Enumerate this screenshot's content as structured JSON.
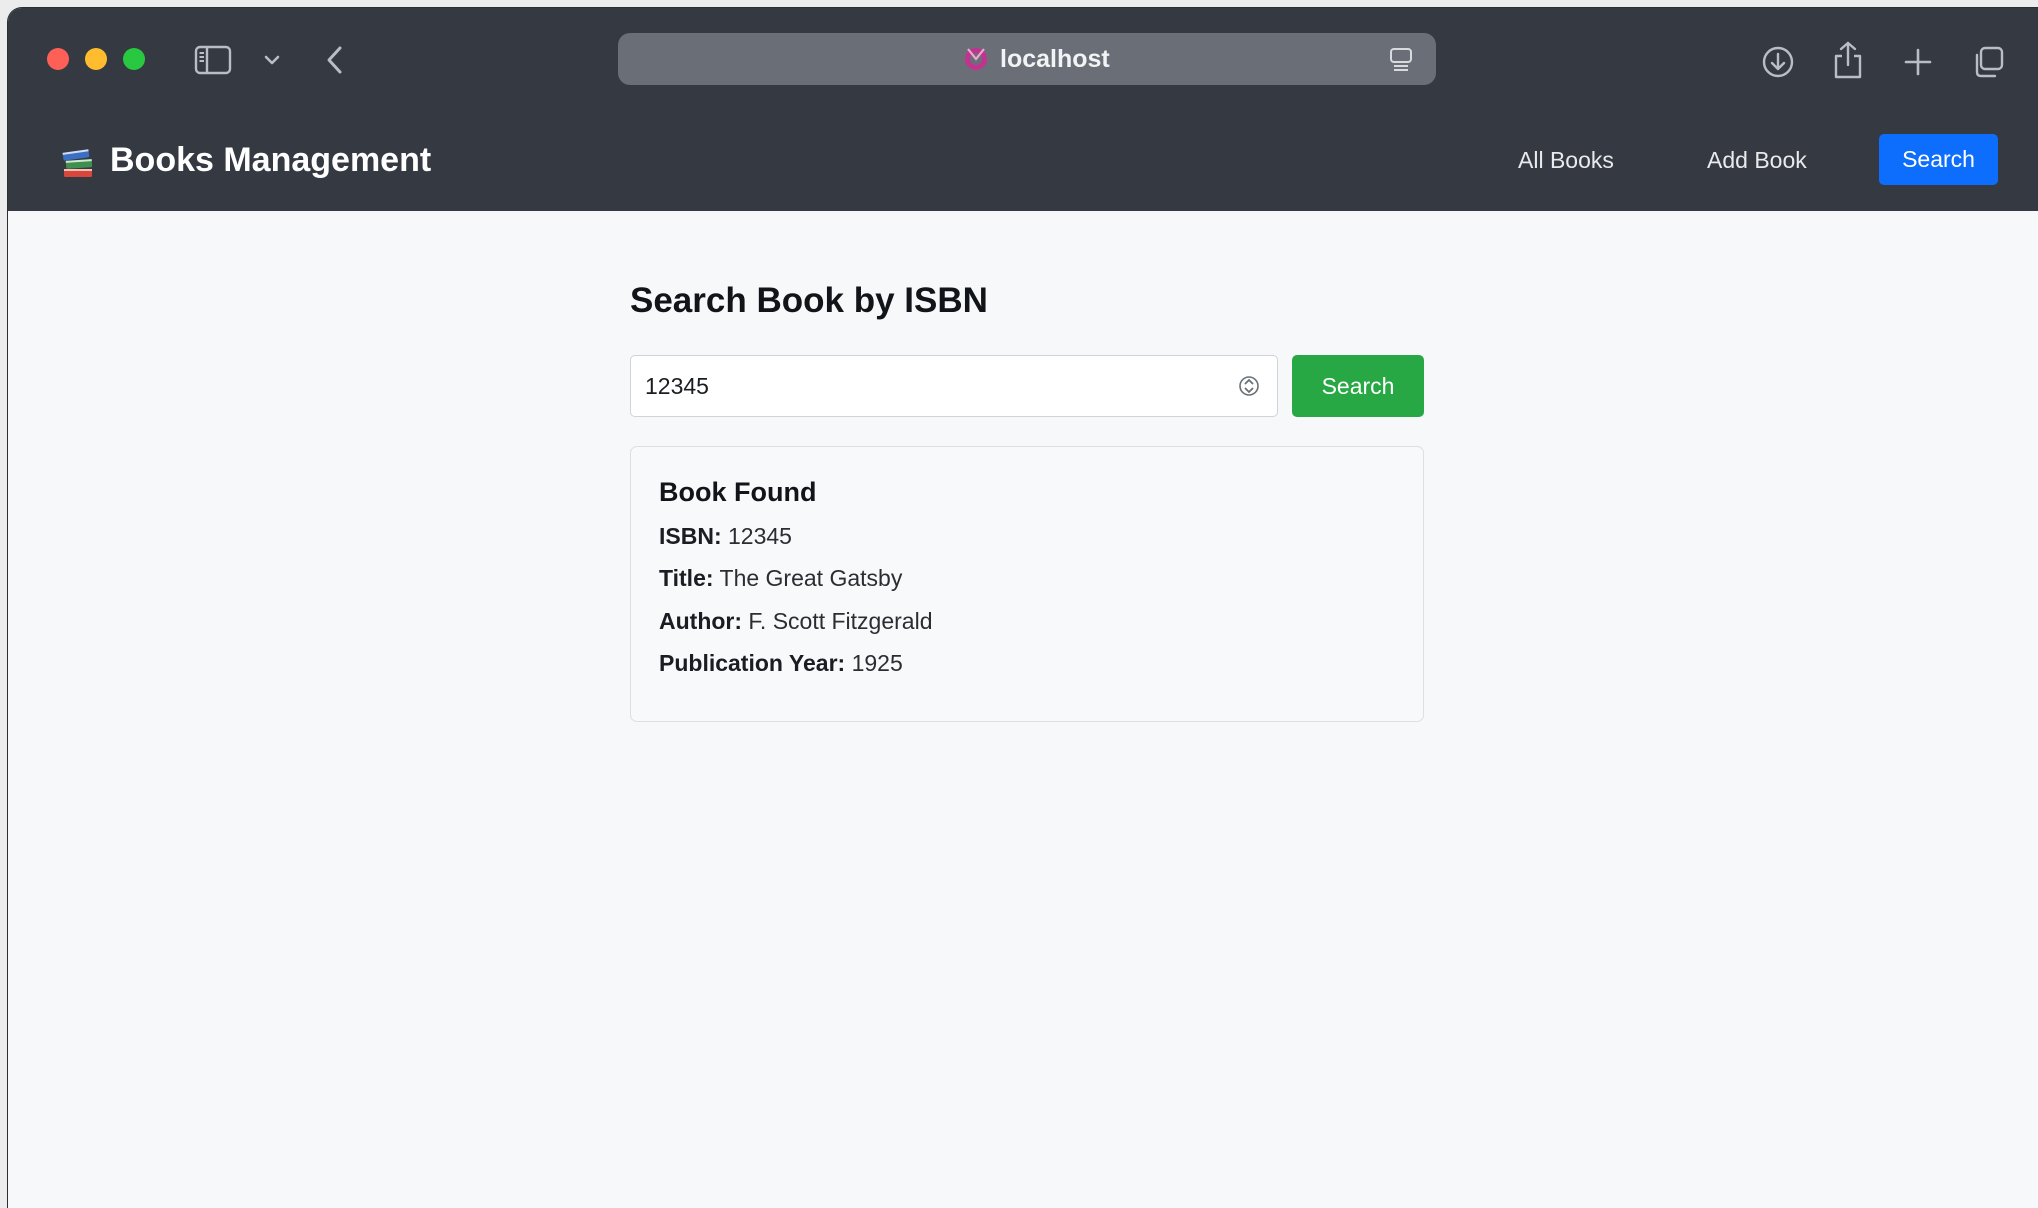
{
  "browser": {
    "address": "localhost"
  },
  "navbar": {
    "brand_title": "Books Management",
    "links": {
      "all_books": "All Books",
      "add_book": "Add Book",
      "search": "Search"
    },
    "active_color": "#0d6efd"
  },
  "search_page": {
    "title": "Search Book by ISBN",
    "isbn_value": "12345",
    "submit_label": "Search",
    "submit_color": "#28a745"
  },
  "result": {
    "heading": "Book Found",
    "isbn_label": "ISBN:",
    "isbn_value": "12345",
    "title_label": "Title:",
    "title_value": "The Great Gatsby",
    "author_label": "Author:",
    "author_value": "F. Scott Fitzgerald",
    "year_label": "Publication Year:",
    "year_value": "1925"
  },
  "icons": {
    "brand": "books-icon",
    "sidebar": "sidebar-icon",
    "back": "chevron-left-icon",
    "download": "download-icon",
    "share": "share-icon",
    "new_tab": "plus-icon",
    "tabs": "tabs-overview-icon",
    "reader": "reader-icon",
    "stepper": "stepper-icon"
  }
}
